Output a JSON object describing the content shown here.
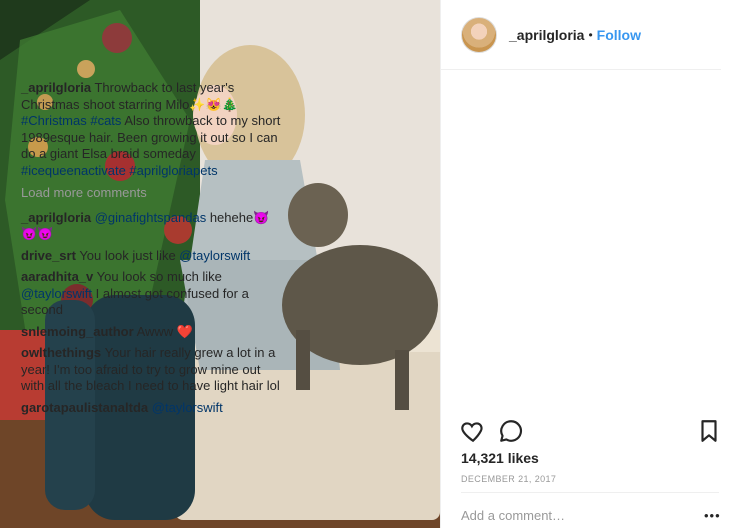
{
  "post": {
    "username": "_aprilgloria",
    "separator": "•",
    "follow_label": "Follow",
    "caption_user": "_aprilgloria",
    "caption_text_1": "Throwback to last year's Christmas shoot starring Milo",
    "caption_emoji": "✨😻🎄",
    "hashtags_1": "#Christmas #cats",
    "caption_text_2": "Also throwback to my short 1989esque hair. Been growing it out so I can do a giant Elsa braid someday",
    "hashtags_2": "#icequeenactivate #aprilgloriapets",
    "load_more": "Load more comments",
    "likes": "14,321 likes",
    "date": "DECEMBER 21, 2017",
    "add_comment_placeholder": "Add a comment…",
    "more_label": "•••"
  },
  "comments": [
    {
      "user": "_aprilgloria",
      "mention": "@ginafightspandas",
      "text": "hehehe😈😈😈"
    },
    {
      "user": "drive_srt",
      "text": "You look just like",
      "mention": "@taylorswift"
    },
    {
      "user": "aaradhita_v",
      "text": "You look so much like",
      "mention": "@taylorswift",
      "text2": "I almost got confused for a second"
    },
    {
      "user": "snlemoing_author",
      "text": "Awww ❤️"
    },
    {
      "user": "owlthethings",
      "text": "Your hair really grew a lot in a year! I'm too afraid to try to grow mine out with all the bleach I need to have light hair lol"
    },
    {
      "user": "garotapaulistanaltda",
      "mention": "@taylorswift"
    }
  ],
  "icons": [
    "heart-icon",
    "comment-icon",
    "bookmark-icon"
  ]
}
